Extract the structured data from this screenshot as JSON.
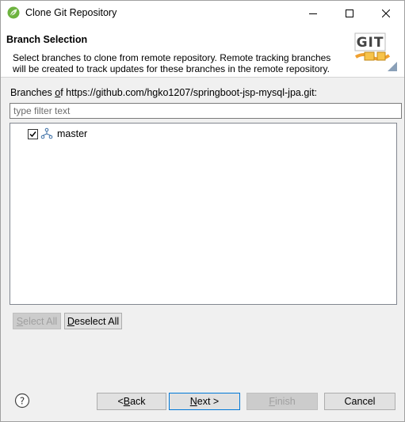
{
  "window": {
    "title": "Clone Git Repository"
  },
  "banner": {
    "title": "Branch Selection",
    "description": "Select branches to clone from remote repository. Remote tracking branches will be created to track updates for these branches in the remote repository.",
    "logo_text": "GIT"
  },
  "branches": {
    "label_prefix": "Branches ",
    "label_mnemonic": "o",
    "label_rest": "f https://github.com/hgko1207/springboot-jsp-mysql-jpa.git:",
    "filter_placeholder": "type filter text",
    "items": [
      {
        "label": "master",
        "checked": true
      }
    ]
  },
  "selection_buttons": {
    "select_all_mn": "S",
    "select_all_rest": "elect All",
    "deselect_all_mn": "D",
    "deselect_all_rest": "eselect All"
  },
  "footer": {
    "back_pre": "< ",
    "back_mn": "B",
    "back_rest": "ack",
    "next_mn": "N",
    "next_rest": "ext >",
    "finish_mn": "F",
    "finish_rest": "inish",
    "cancel": "Cancel"
  },
  "icons": {
    "app": "eclipse-spring-icon",
    "help": "help-icon",
    "branch": "branch-icon"
  }
}
